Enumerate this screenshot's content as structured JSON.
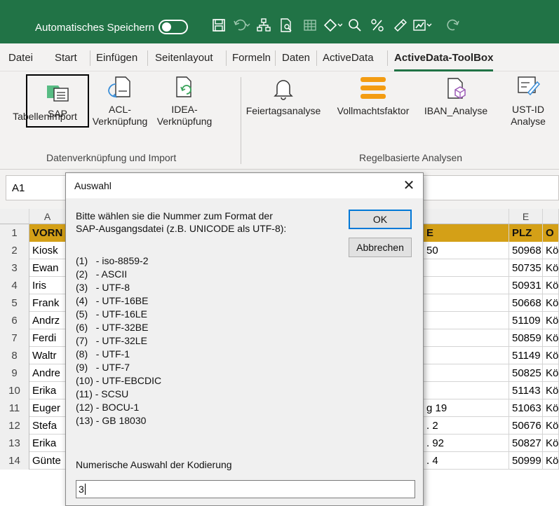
{
  "titlebar": {
    "autosave_label": "Automatisches Speichern",
    "autosave_state": "off",
    "accent": "#217346"
  },
  "tabs": [
    "Datei",
    "Start",
    "Einfügen",
    "Seitenlayout",
    "Formeln",
    "Daten",
    "ActiveData",
    "ActiveData-ToolBox"
  ],
  "active_tab": "ActiveData-ToolBox",
  "ribbon": {
    "group1": {
      "label": "Datenverknüpfung und Import",
      "buttons": [
        {
          "line1": "SAP",
          "line2": "TabellenImport",
          "icon": "sap-table-import-icon"
        },
        {
          "line1": "ACL-",
          "line2": "Verknüpfung",
          "icon": "acl-link-icon"
        },
        {
          "line1": "IDEA-",
          "line2": "Verknüpfung",
          "icon": "idea-link-icon"
        }
      ]
    },
    "group2": {
      "label": "Regelbasierte Analysen",
      "buttons": [
        {
          "line1": "Feiertagsanalyse",
          "icon": "bell-icon"
        },
        {
          "line1": "Vollmachtsfaktor",
          "icon": "stacked-bars-icon"
        },
        {
          "line1": "IBAN_Analyse",
          "icon": "iban-analysis-icon"
        },
        {
          "line1": "UST-ID",
          "line2": "Analyse",
          "icon": "ust-id-edit-icon"
        }
      ]
    }
  },
  "namebox": "A1",
  "grid": {
    "columns": [
      "A",
      "E"
    ],
    "header_row": {
      "a": "VORN",
      "d": "E",
      "e": "PLZ",
      "f": "O"
    },
    "rows": [
      {
        "n": "1"
      },
      {
        "n": "2",
        "a": "Kiosk",
        "d": "50",
        "e": "50968",
        "f": "Kö"
      },
      {
        "n": "3",
        "a": "Ewan",
        "d": "",
        "e": "50735",
        "f": "Kö"
      },
      {
        "n": "4",
        "a": "Iris",
        "d": "",
        "e": "50931",
        "f": "Kö"
      },
      {
        "n": "5",
        "a": "Frank",
        "d": "",
        "e": "50668",
        "f": "Kö"
      },
      {
        "n": "6",
        "a": "Andrz",
        "d": "",
        "e": "51109",
        "f": "Kö"
      },
      {
        "n": "7",
        "a": "Ferdi",
        "d": "",
        "e": "50859",
        "f": "Kö"
      },
      {
        "n": "8",
        "a": "Waltr",
        "d": "",
        "e": "51149",
        "f": "Kö"
      },
      {
        "n": "9",
        "a": "Andre",
        "d": "",
        "e": "50825",
        "f": "Kö"
      },
      {
        "n": "10",
        "a": "Erika",
        "d": "",
        "e": "51143",
        "f": "Kö"
      },
      {
        "n": "11",
        "a": "Euger",
        "d": "g 19",
        "e": "51063",
        "f": "Kö"
      },
      {
        "n": "12",
        "a": "Stefa",
        "d": ". 2",
        "e": "50676",
        "f": "Kö"
      },
      {
        "n": "13",
        "a": "Erika",
        "d": ". 92",
        "e": "50827",
        "f": "Kö"
      },
      {
        "n": "14",
        "a": "Günte",
        "d": ". 4",
        "e": "50999",
        "f": "Kö"
      }
    ]
  },
  "dialog": {
    "title": "Auswahl",
    "prompt_line1": "Bitte wählen sie die Nummer zum Format der",
    "prompt_line2": "SAP-Ausgangsdatei (z.B. UNICODE als UTF-8):",
    "ok_label": "OK",
    "cancel_label": "Abbrechen",
    "options": [
      "(1)   - iso-8859-2",
      "(2)   - ASCII",
      "(3)   - UTF-8",
      "(4)   - UTF-16BE",
      "(5)   - UTF-16LE",
      "(6)   - UTF-32BE",
      "(7)   - UTF-32LE",
      "(8)   - UTF-1",
      "(9)   - UTF-7",
      "(10) - UTF-EBCDIC",
      "(11) - SCSU",
      "(12) - BOCU-1",
      "(13) - GB 18030"
    ],
    "input_label": "Numerische Auswahl der Kodierung",
    "input_value": "3"
  }
}
